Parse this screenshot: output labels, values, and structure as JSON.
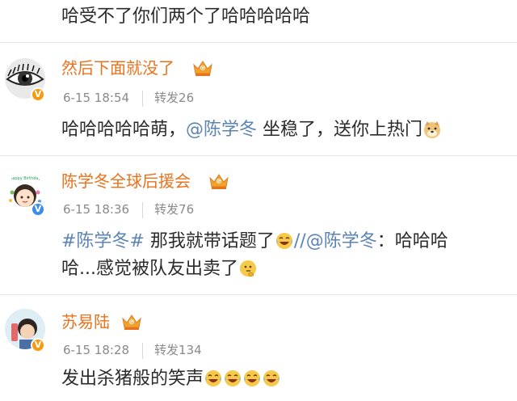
{
  "top": {
    "text": "哈受不了你们两个了哈哈哈哈哈"
  },
  "comments": [
    {
      "name": "然后下面就没了",
      "time": "6-15 18:54",
      "repost": "转发26",
      "body_pre": "哈哈哈哈哈萌，",
      "mention": "@陈学冬",
      "body_post": " 坐稳了，送你上热门"
    },
    {
      "name": "陈学冬全球后援会",
      "time": "6-15 18:36",
      "repost": "转发76",
      "hashtag": "#陈学冬#",
      "line1_mid": " 那我就带话题了",
      "line1_sep": "//",
      "mention": "@陈学冬",
      "line1_end": "：哈哈哈",
      "line2": "哈...感觉被队友出卖了",
      "avatar_text": "Happy Birthday"
    },
    {
      "name": "苏易陆",
      "time": "6-15 18:28",
      "repost": "转发134",
      "body": "发出杀猪般的笑声"
    }
  ],
  "colors": {
    "name": "#e8731c",
    "link": "#5b84b5",
    "meta": "#8a8a8a",
    "text": "#2b2b2b",
    "separator": "#e6e6e6",
    "crown": "#f0a22b"
  },
  "icons": {
    "crown": "vip-crown-icon",
    "verified_orange": "verified-v-icon",
    "verified_blue": "verified-v-icon",
    "doge": "doge-emoji-icon",
    "laugh": "laugh-tears-emoji-icon",
    "think": "thinking-emoji-icon"
  }
}
